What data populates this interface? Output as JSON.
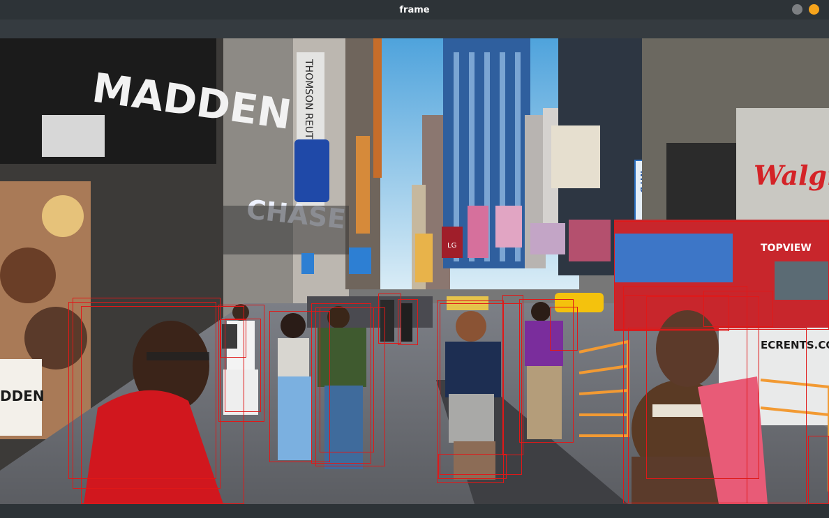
{
  "window": {
    "title": "frame",
    "controls": [
      "minimize",
      "close"
    ]
  },
  "scene": {
    "signs": {
      "madden": "MADDEN",
      "chase": "CHASE",
      "thomson": "THOMSON REUTE",
      "nypd": "NYPD",
      "walgreens": "Walgre",
      "topview": "TOPVIEW",
      "rentals": "ECRENTS.COM",
      "lg": "LG",
      "poster": "DDEN"
    }
  },
  "detections": {
    "box_color": "#e01818",
    "box_count": 25
  }
}
